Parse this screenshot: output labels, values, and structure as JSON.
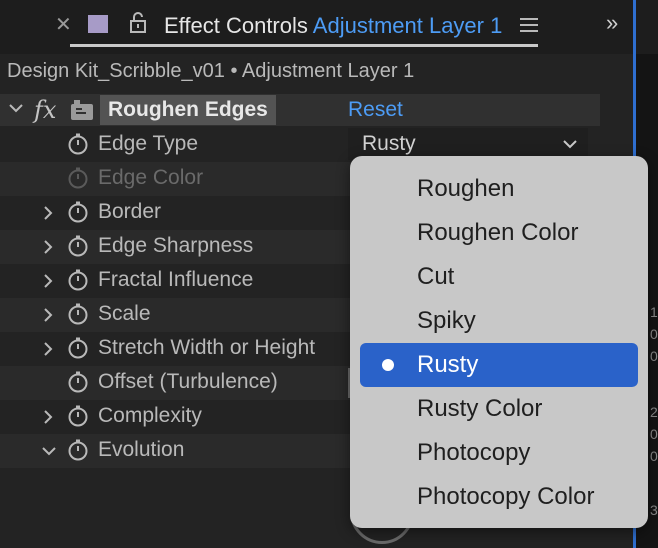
{
  "panel": {
    "title_prefix": "Effect Controls",
    "title_layer": "Adjustment Layer 1",
    "more_glyph": "»",
    "breadcrumb": "Design Kit_Scribble_v01 • Adjustment Layer 1"
  },
  "effect": {
    "fx_label": "fx",
    "name": "Roughen Edges",
    "reset_label": "Reset",
    "edge_type_value": "Rusty"
  },
  "properties": [
    {
      "label": "Edge Type",
      "expandable": false,
      "disabled": false
    },
    {
      "label": "Edge Color",
      "expandable": false,
      "disabled": true
    },
    {
      "label": "Border",
      "expandable": true,
      "disabled": false
    },
    {
      "label": "Edge Sharpness",
      "expandable": true,
      "disabled": false
    },
    {
      "label": "Fractal Influence",
      "expandable": true,
      "disabled": false
    },
    {
      "label": "Scale",
      "expandable": true,
      "disabled": false
    },
    {
      "label": "Stretch Width or Height",
      "expandable": true,
      "disabled": false
    },
    {
      "label": "Offset (Turbulence)",
      "expandable": false,
      "disabled": false
    },
    {
      "label": "Complexity",
      "expandable": true,
      "disabled": false
    },
    {
      "label": "Evolution",
      "expandable": true,
      "disabled": false,
      "expanded": true
    }
  ],
  "dropdown_menu": {
    "options": [
      "Roughen",
      "Roughen Color",
      "Cut",
      "Spiky",
      "Rusty",
      "Rusty Color",
      "Photocopy",
      "Photocopy Color"
    ],
    "selected": "Rusty"
  },
  "right_strip_text": [
    "1",
    "0",
    "0",
    "2",
    "0",
    "0",
    "3"
  ],
  "colors": {
    "accent": "#4d9cf5",
    "selection": "#2a62c9",
    "layer_swatch": "#a79bc7",
    "panel_bg": "#232323",
    "menu_bg": "#c8c8c8"
  },
  "icons": [
    "close-icon",
    "color-swatch-icon",
    "lock-icon",
    "hamburger-menu-icon",
    "chevron-right-double-icon",
    "chevron-down-icon",
    "effect-icon",
    "stopwatch-icon",
    "expand-arrow-icon"
  ]
}
